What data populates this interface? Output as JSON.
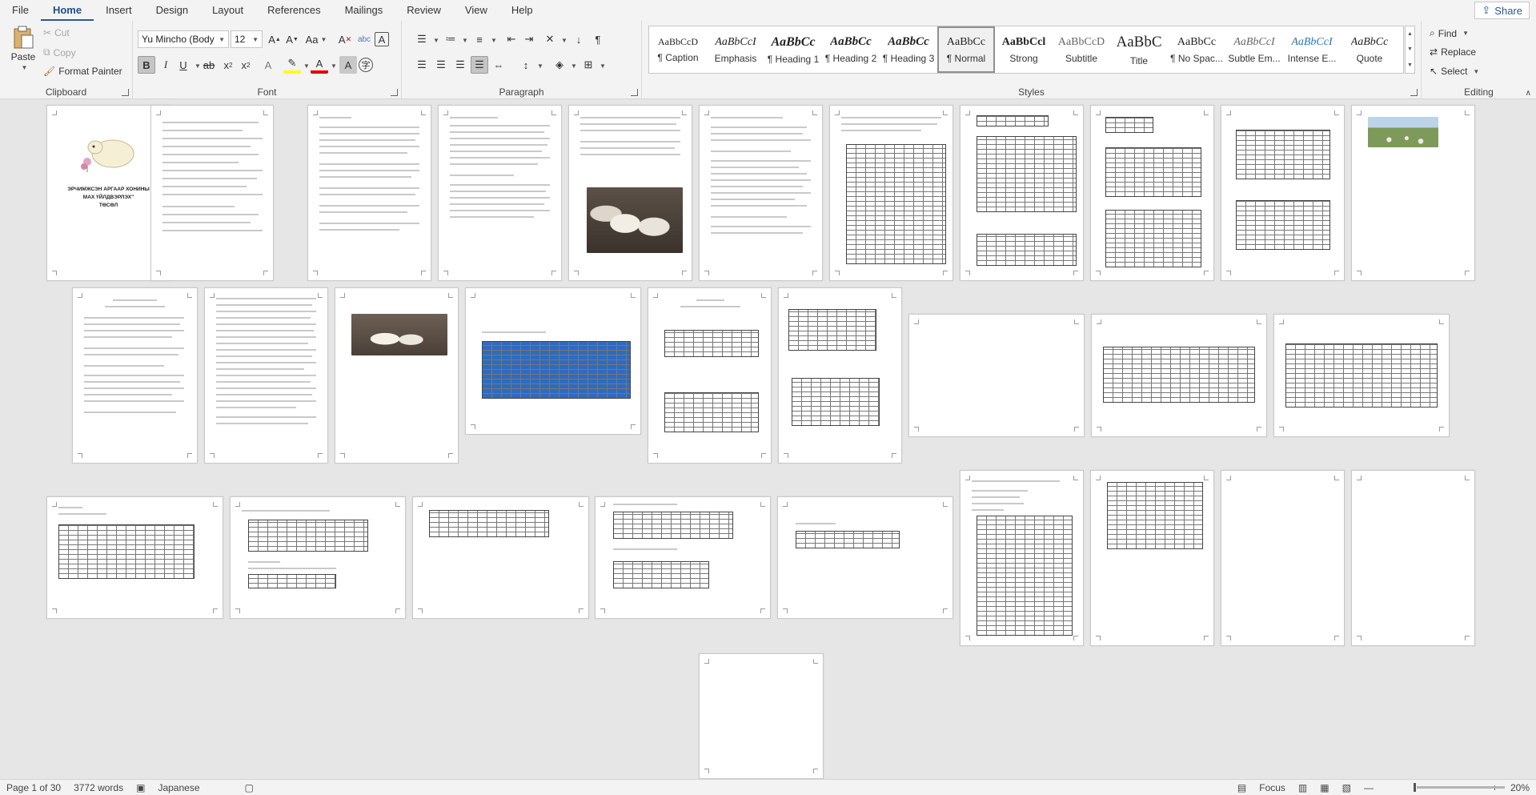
{
  "tabs": [
    "File",
    "Home",
    "Insert",
    "Design",
    "Layout",
    "References",
    "Mailings",
    "Review",
    "View",
    "Help"
  ],
  "active_tab": "Home",
  "share_label": "Share",
  "clipboard": {
    "group_label": "Clipboard",
    "paste": "Paste",
    "cut": "Cut",
    "copy": "Copy",
    "format_painter": "Format Painter"
  },
  "font": {
    "group_label": "Font",
    "font_name": "Yu Mincho (Body",
    "font_size": "12"
  },
  "paragraph": {
    "group_label": "Paragraph"
  },
  "styles": {
    "group_label": "Styles",
    "items": [
      {
        "sample": "AaBbCcD",
        "name": "¶ Caption"
      },
      {
        "sample": "AaBbCcI",
        "name": "Emphasis"
      },
      {
        "sample": "AaBbCc",
        "name": "¶ Heading 1"
      },
      {
        "sample": "AaBbCc",
        "name": "¶ Heading 2"
      },
      {
        "sample": "AaBbCc",
        "name": "¶ Heading 3"
      },
      {
        "sample": "AaBbCc",
        "name": "¶ Normal"
      },
      {
        "sample": "AaBbCcl",
        "name": "Strong"
      },
      {
        "sample": "AaBbCcD",
        "name": "Subtitle"
      },
      {
        "sample": "AaBbC",
        "name": "Title"
      },
      {
        "sample": "AaBbCc",
        "name": "¶ No Spac..."
      },
      {
        "sample": "AaBbCcI",
        "name": "Subtle Em..."
      },
      {
        "sample": "AaBbCcI",
        "name": "Intense E..."
      },
      {
        "sample": "AaBbCc",
        "name": "Quote"
      }
    ],
    "selected": "¶ Normal"
  },
  "editing": {
    "group_label": "Editing",
    "find": "Find",
    "replace": "Replace",
    "select": "Select"
  },
  "document": {
    "cover_title_line1": "ЭРЧИМЖСЭН АРГААР ХОНИНЫ",
    "cover_title_line2": "МАХ ҮЙЛДВЭРЛЭХ\"",
    "cover_title_line3": "ТӨСӨЛ"
  },
  "status": {
    "page": "Page 1 of 30",
    "words": "3772 words",
    "language": "Japanese",
    "focus": "Focus",
    "zoom": "20%"
  }
}
